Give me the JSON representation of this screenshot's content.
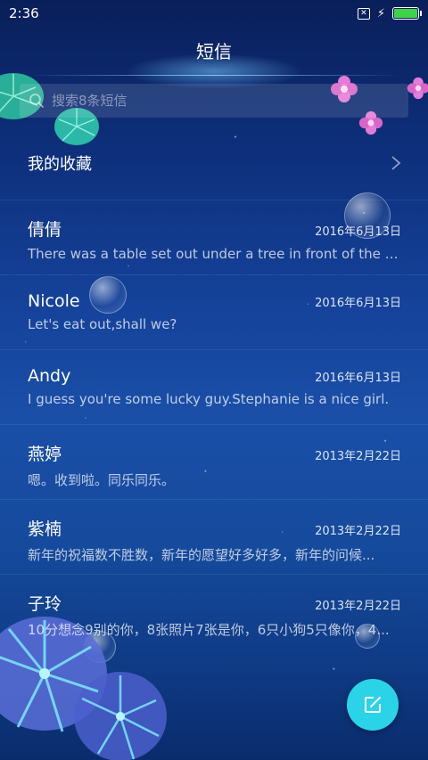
{
  "status_bar": {
    "time": "2:36",
    "sim_symbol": "✕",
    "battery_level": 1.0,
    "battery_color": "#3ed44a"
  },
  "header": {
    "title": "短信"
  },
  "search": {
    "placeholder": "搜索8条短信",
    "value": ""
  },
  "favorites": {
    "label": "我的收藏"
  },
  "conversations": [
    {
      "name": "倩倩",
      "date": "2016年6月13日",
      "preview": "There was a table set out under a tree in front of the ho..."
    },
    {
      "name": "Nicole",
      "date": "2016年6月13日",
      "preview": "Let's eat out,shall we?"
    },
    {
      "name": "Andy",
      "date": "2016年6月13日",
      "preview": "I guess you're some lucky guy.Stephanie is a nice girl."
    },
    {
      "name": "燕婷",
      "date": "2013年2月22日",
      "preview": "嗯。收到啦。同乐同乐。"
    },
    {
      "name": "紫楠",
      "date": "2013年2月22日",
      "preview": "新年的祝福数不胜数，新年的愿望好多好多，新年的问候..."
    },
    {
      "name": "子玲",
      "date": "2013年2月22日",
      "preview": "10分想念9别的你，8张照片7张是你，6只小狗5只像你，4..."
    }
  ],
  "colors": {
    "accent": "#2ad3e8",
    "background_top": "#0a1f5a",
    "background_mid": "#1a4fa8"
  }
}
